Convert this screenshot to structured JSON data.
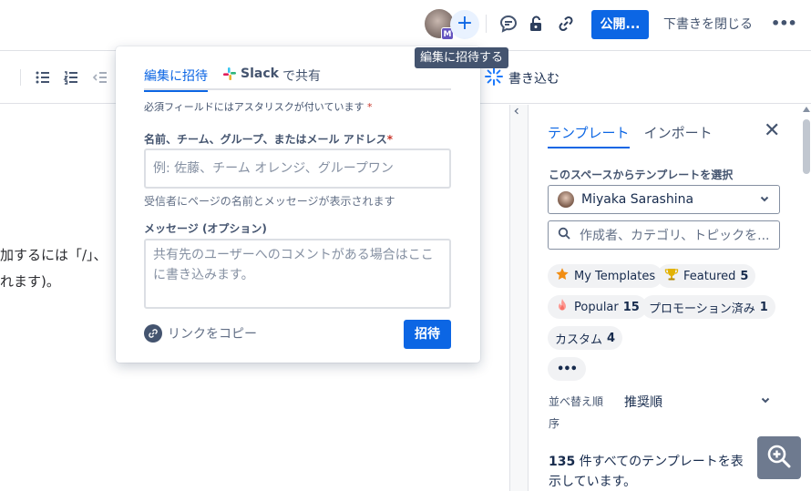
{
  "topbar": {
    "avatar_badge": "M",
    "add_icon": "+",
    "publish_label": "公開...",
    "close_draft_label": "下書きを閉じる",
    "more_label": "•••",
    "tooltip": "編集に招待する"
  },
  "toolbar": {
    "write_label": "書き込む"
  },
  "editor": {
    "line1": "加するには「/」、",
    "line2": "れます)。"
  },
  "popup": {
    "tab_invite": "編集に招待",
    "tab_slack_bold": "Slack",
    "tab_slack_rest": "で共有",
    "required_note": "必須フィールドにはアスタリスクが付いています",
    "asterisk": "*",
    "recipient_label": "名前、チーム、グループ、またはメール アドレス",
    "recipient_placeholder": "例: 佐藤、チーム オレンジ、グループワン",
    "recipient_help": "受信者にページの名前とメッセージが表示されます",
    "message_label": "メッセージ (オプション)",
    "message_placeholder": "共有先のユーザーへのコメントがある場合はここに書き込みます。",
    "copy_link_label": "リンクをコピー",
    "invite_button": "招待"
  },
  "right_panel": {
    "tab_templates": "テンプレート",
    "tab_import": "インポート",
    "close_icon": "✕",
    "space_label": "このスペースからテンプレートを選択",
    "selected_user": "Miyaka Sarashina",
    "search_placeholder": "作成者、カテゴリ、トピックを...",
    "chips": [
      {
        "label": "My Templates",
        "count": ""
      },
      {
        "label": "Featured",
        "count": "5"
      },
      {
        "label": "Popular",
        "count": "15"
      },
      {
        "label": "プロモーション済み",
        "count": "1"
      },
      {
        "label": "カスタム",
        "count": "4"
      },
      {
        "label": "•••",
        "count": ""
      }
    ],
    "sort_label": "並べ替え順序",
    "sort_value": "推奨順",
    "count_number": "135",
    "count_text": " 件すべてのテンプレートを表示しています。"
  },
  "colors": {
    "accent": "#0c66e4",
    "text": "#172b4d",
    "subtle": "#44546f",
    "required": "#c9372c"
  }
}
